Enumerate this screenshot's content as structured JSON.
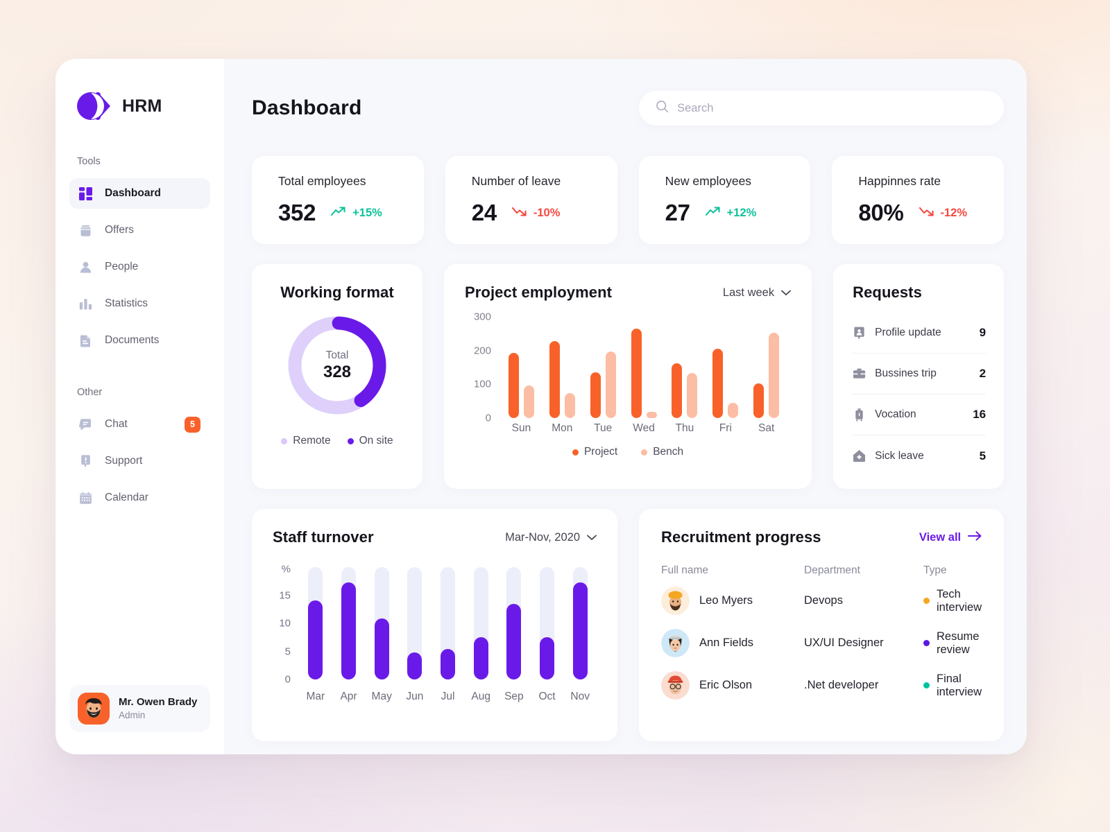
{
  "brand": {
    "name": "HRM",
    "logo_icon": "hrm-logo-icon"
  },
  "sidebar": {
    "groups": [
      {
        "label": "Tools",
        "items": [
          {
            "label": "Dashboard",
            "icon": "dashboard-grid-icon",
            "active": true
          },
          {
            "label": "Offers",
            "icon": "offers-box-icon",
            "active": false
          },
          {
            "label": "People",
            "icon": "people-person-icon",
            "active": false
          },
          {
            "label": "Statistics",
            "icon": "statistics-bars-icon",
            "active": false
          },
          {
            "label": "Documents",
            "icon": "documents-file-icon",
            "active": false
          }
        ]
      },
      {
        "label": "Other",
        "items": [
          {
            "label": "Chat",
            "icon": "chat-bubble-icon",
            "badge": "5",
            "active": false
          },
          {
            "label": "Support",
            "icon": "support-alert-icon",
            "active": false
          },
          {
            "label": "Calendar",
            "icon": "calendar-icon",
            "active": false
          }
        ]
      }
    ],
    "user": {
      "name": "Mr. Owen Brady",
      "role": "Admin",
      "avatar_icon": "user-avatar"
    }
  },
  "header": {
    "title": "Dashboard",
    "search": {
      "placeholder": "Search",
      "value": "",
      "icon": "search-icon"
    }
  },
  "stats": [
    {
      "title": "Total employees",
      "value": "352",
      "delta": "+15%",
      "direction": "up",
      "icon": "trend-up-icon"
    },
    {
      "title": "Number of leave",
      "value": "24",
      "delta": "-10%",
      "direction": "down",
      "icon": "trend-down-icon"
    },
    {
      "title": "New employees",
      "value": "27",
      "delta": "+12%",
      "direction": "up",
      "icon": "trend-up-icon"
    },
    {
      "title": "Happinnes rate",
      "value": "80%",
      "delta": "-12%",
      "direction": "down",
      "icon": "trend-down-icon"
    }
  ],
  "working_format": {
    "title": "Working format",
    "center_label": "Total",
    "center_value": "328",
    "legend": [
      {
        "label": "Remote",
        "color": "#d8c8fb"
      },
      {
        "label": "On site",
        "color": "#6a1ae8"
      }
    ]
  },
  "project_employment": {
    "title": "Project employment",
    "range_label": "Last week",
    "range_icon": "chevron-down-icon",
    "legend": [
      {
        "label": "Project",
        "color": "#f8622a"
      },
      {
        "label": "Bench",
        "color": "#fbbda3"
      }
    ]
  },
  "requests": {
    "title": "Requests",
    "items": [
      {
        "label": "Profile update",
        "count": "9",
        "icon": "profile-badge-icon"
      },
      {
        "label": "Bussines trip",
        "count": "2",
        "icon": "briefcase-icon"
      },
      {
        "label": "Vocation",
        "count": "16",
        "icon": "suitcase-icon"
      },
      {
        "label": "Sick leave",
        "count": "5",
        "icon": "first-aid-icon"
      }
    ]
  },
  "staff_turnover": {
    "title": "Staff turnover",
    "range_label": "Mar-Nov, 2020",
    "range_icon": "chevron-down-icon"
  },
  "recruitment": {
    "title": "Recruitment progress",
    "view_all_label": "View all",
    "view_all_icon": "arrow-right-icon",
    "columns": [
      "Full name",
      "Department",
      "Type"
    ],
    "rows": [
      {
        "name": "Leo Myers",
        "department": "Devops",
        "type": "Tech interview",
        "type_color": "#f5a623",
        "avatar": "leo-myers-avatar"
      },
      {
        "name": "Ann Fields",
        "department": "UX/UI Designer",
        "type": "Resume review",
        "type_color": "#5b18e0",
        "avatar": "ann-fields-avatar"
      },
      {
        "name": "Eric Olson",
        "department": ".Net developer",
        "type": "Final interview",
        "type_color": "#00c4a0",
        "avatar": "eric-olson-avatar"
      }
    ]
  },
  "chart_data": [
    {
      "type": "pie",
      "title": "Working format",
      "labels": [
        "On site",
        "Remote"
      ],
      "values": [
        40,
        60
      ],
      "total": 328,
      "colors": [
        "#6a1ae8",
        "#d8c8fb"
      ],
      "legend_position": "bottom",
      "grid": false
    },
    {
      "type": "bar",
      "title": "Project employment",
      "categories": [
        "Sun",
        "Mon",
        "Tue",
        "Wed",
        "Thu",
        "Fri",
        "Sat"
      ],
      "series": [
        {
          "name": "Project",
          "color": "#f8622a",
          "values": [
            193,
            228,
            135,
            265,
            162,
            205,
            103
          ]
        },
        {
          "name": "Bench",
          "color": "#fbbda3",
          "values": [
            97,
            73,
            198,
            18,
            133,
            45,
            253
          ]
        }
      ],
      "xlabel": "",
      "ylabel": "",
      "ylim": [
        0,
        300
      ],
      "yticks": [
        0,
        100,
        200,
        300
      ],
      "grid": false,
      "legend_position": "bottom"
    },
    {
      "type": "bar",
      "title": "Staff turnover",
      "categories": [
        "Mar",
        "Apr",
        "May",
        "Jun",
        "Jul",
        "Aug",
        "Sep",
        "Oct",
        "Nov"
      ],
      "values": [
        13,
        16,
        10,
        4.5,
        5,
        7,
        12.5,
        7,
        16
      ],
      "xlabel": "",
      "ylabel": "%",
      "ylim": [
        0,
        18.5
      ],
      "yticks": [
        0,
        5,
        10,
        15
      ],
      "track_max": 18.5,
      "color": "#6a1ae8",
      "track_color": "#eceefa",
      "grid": false
    }
  ]
}
